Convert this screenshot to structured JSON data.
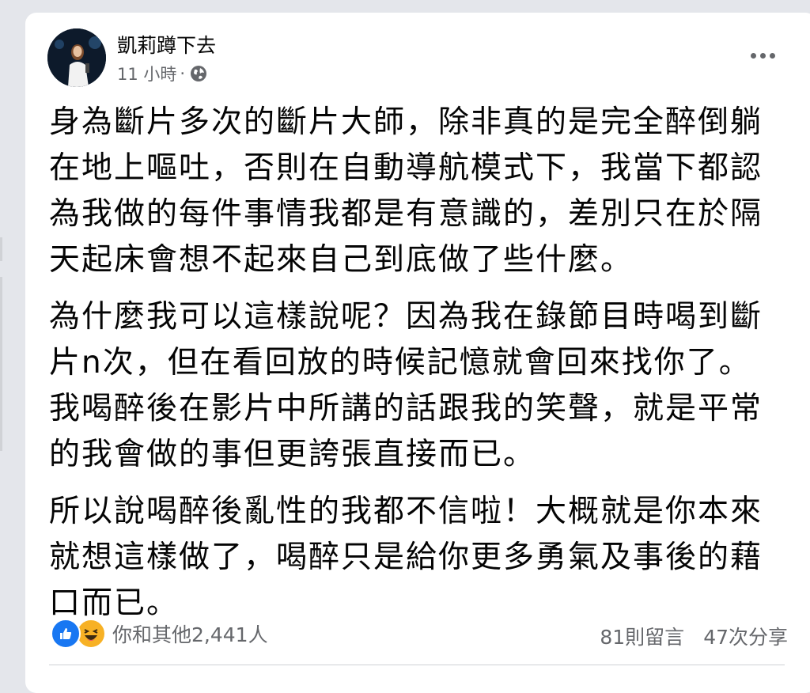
{
  "post": {
    "author": "凱莉蹲下去",
    "time": "11 小時",
    "separator": "·",
    "privacy_icon": "globe-icon",
    "paragraphs": [
      [
        "身為斷片多次的斷片大師，除非真的是完全醉倒躺",
        "在地上嘔吐，否則在自動導航模式下，我當下都認",
        "為我做的每件事情我都是有意識的，差別只在於隔",
        "天起床會想不起來自己到底做了些什麼。"
      ],
      [
        "為什麼我可以這樣說呢？因為我在錄節目時喝到斷",
        "片n次，但在看回放的時候記憶就會回來找你了。",
        "我喝醉後在影片中所講的話跟我的笑聲，就是平常",
        "的我會做的事但更誇張直接而已。"
      ],
      [
        "所以說喝醉後亂性的我都不信啦！大概就是你本來",
        "就想這樣做了，喝醉只是給你更多勇氣及事後的藉",
        "口而已。"
      ]
    ],
    "reactions": {
      "icons": [
        "like-icon",
        "haha-icon"
      ],
      "label": "你和其他2,441人"
    },
    "comments_label": "81則留言",
    "shares_label": "47次分享"
  },
  "colors": {
    "background": "#e4e6eb",
    "card": "#ffffff",
    "text": "#050505",
    "secondary_text": "#65676b",
    "like_blue": "#1877f2",
    "haha_yellow": "#f7b125"
  }
}
